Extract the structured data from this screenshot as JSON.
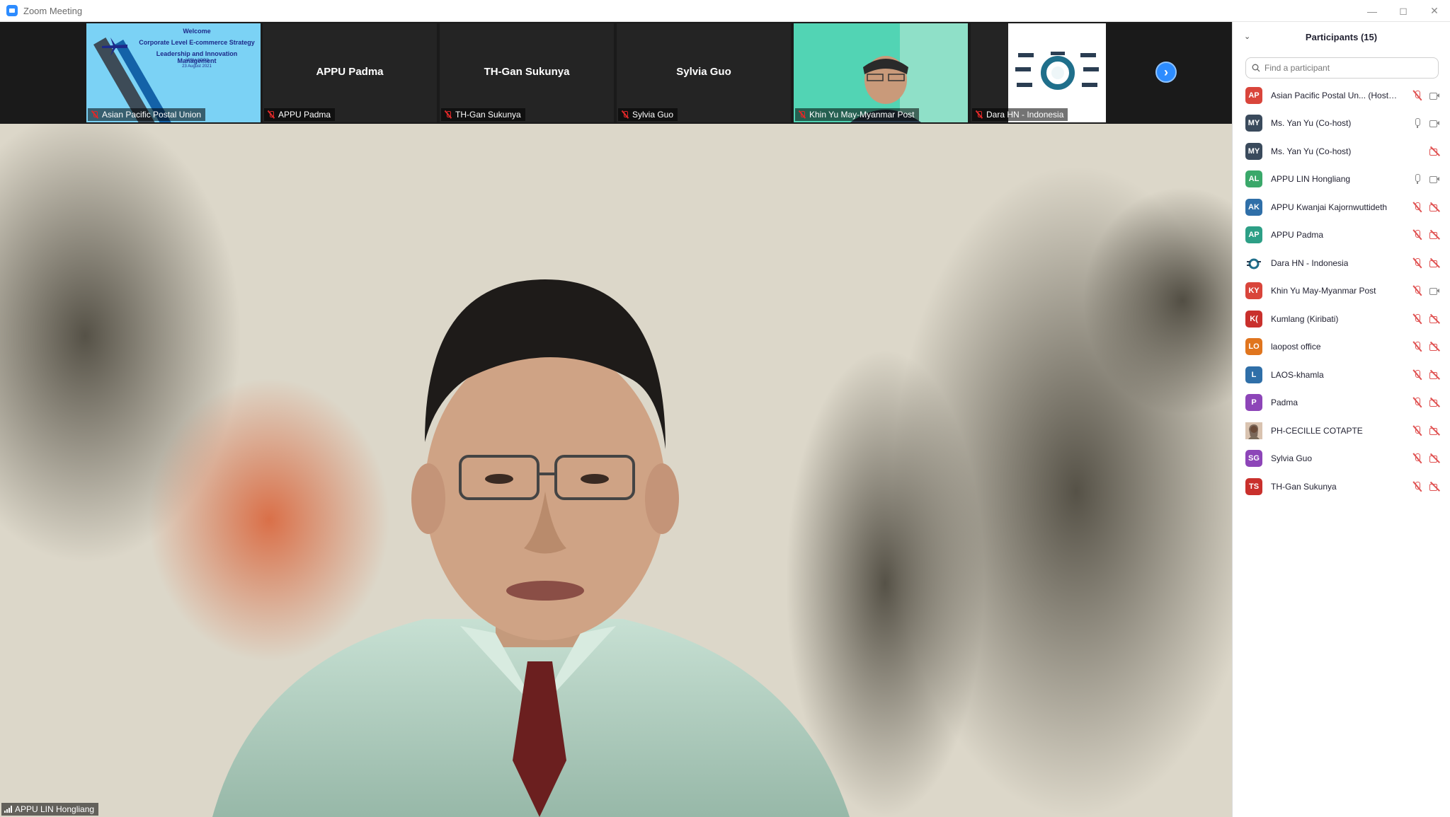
{
  "window": {
    "title": "Zoom Meeting"
  },
  "thumbnails": [
    {
      "name": "Asian Pacific Postal Union",
      "center_name": "",
      "type": "slide"
    },
    {
      "name": "APPU Padma",
      "center_name": "APPU Padma",
      "type": "name"
    },
    {
      "name": "TH-Gan Sukunya",
      "center_name": "TH-Gan Sukunya",
      "type": "name"
    },
    {
      "name": "Sylvia Guo",
      "center_name": "Sylvia Guo",
      "type": "name"
    },
    {
      "name": "Khin Yu May-Myanmar Post",
      "center_name": "",
      "type": "video"
    },
    {
      "name": "Dara HN - Indonesia",
      "center_name": "",
      "type": "image"
    }
  ],
  "slide": {
    "line1": "Welcome",
    "line2": "Corporate Level E-commerce Strategy",
    "line3": "Leadership and Innovation Management",
    "line4": "APPU SDPS",
    "line5": "23 August 2021"
  },
  "speaker": {
    "name": "APPU LIN Hongliang"
  },
  "participants_panel": {
    "title": "Participants (15)",
    "search_placeholder": "Find a participant",
    "participants": [
      {
        "initials": "AP",
        "name": "Asian Pacific Postal Un... (Host, me)",
        "color": "#d9453b",
        "mic": "off",
        "cam": "on"
      },
      {
        "initials": "MY",
        "name": "Ms. Yan Yu (Co-host)",
        "color": "#3a4a5c",
        "mic": "on",
        "cam": "on"
      },
      {
        "initials": "MY",
        "name": "Ms. Yan Yu (Co-host)",
        "color": "#3a4a5c",
        "mic": "none",
        "cam": "off"
      },
      {
        "initials": "AL",
        "name": "APPU LIN Hongliang",
        "color": "#3aa86a",
        "mic": "on",
        "cam": "on"
      },
      {
        "initials": "AK",
        "name": "APPU Kwanjai Kajornwuttideth",
        "color": "#2f6fa8",
        "mic": "off",
        "cam": "off"
      },
      {
        "initials": "AP",
        "name": "APPU Padma",
        "color": "#2d9f86",
        "mic": "off",
        "cam": "off"
      },
      {
        "initials": "",
        "name": "Dara HN - Indonesia",
        "color": "#ffffff",
        "mic": "off",
        "cam": "off",
        "icon": "logo-avatar-icon"
      },
      {
        "initials": "KY",
        "name": "Khin Yu May-Myanmar Post",
        "color": "#d9453b",
        "mic": "off",
        "cam": "on"
      },
      {
        "initials": "K(",
        "name": "Kumlang (Kiribati)",
        "color": "#c9302c",
        "mic": "off",
        "cam": "off"
      },
      {
        "initials": "LO",
        "name": "laopost office",
        "color": "#e0751e",
        "mic": "off",
        "cam": "off"
      },
      {
        "initials": "L",
        "name": "LAOS-khamla",
        "color": "#2f6fa8",
        "mic": "off",
        "cam": "off"
      },
      {
        "initials": "P",
        "name": "Padma",
        "color": "#8d45b8",
        "mic": "off",
        "cam": "off"
      },
      {
        "initials": "",
        "name": "PH-CECILLE COTAPTE",
        "color": "#c98c6c",
        "mic": "off",
        "cam": "off",
        "icon": "photo-avatar-icon"
      },
      {
        "initials": "SG",
        "name": "Sylvia Guo",
        "color": "#8d45b8",
        "mic": "off",
        "cam": "off"
      },
      {
        "initials": "TS",
        "name": "TH-Gan Sukunya",
        "color": "#c9302c",
        "mic": "off",
        "cam": "off"
      }
    ]
  }
}
